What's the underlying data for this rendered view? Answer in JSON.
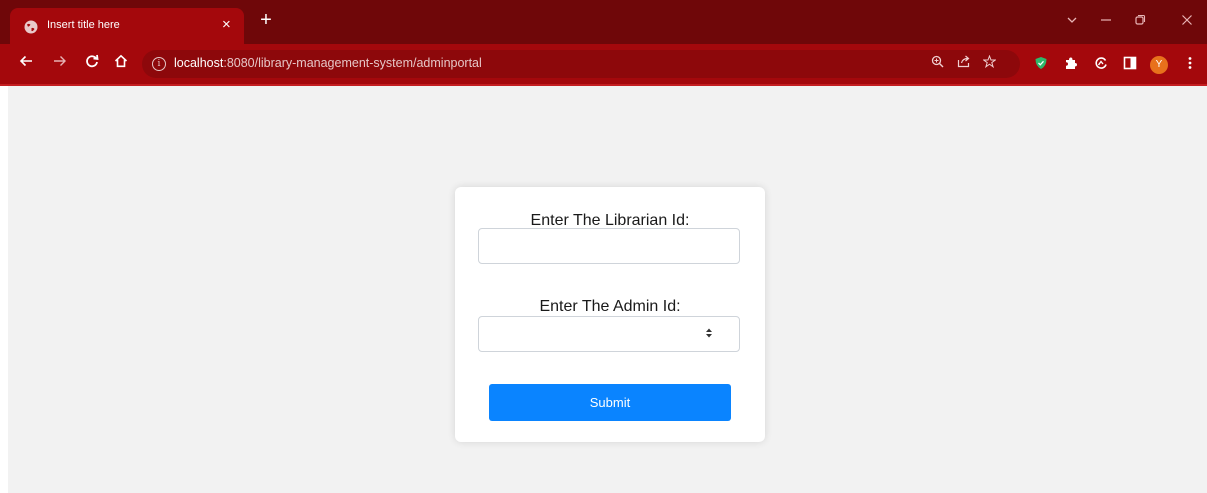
{
  "browser": {
    "tab_title": "Insert title here",
    "close_glyph": "×",
    "new_tab_glyph": "+",
    "url_host": "localhost",
    "url_path": ":8080/library-management-system/adminportal",
    "avatar_letter": "Y"
  },
  "icons": {
    "favicon": "globe-icon",
    "back": "back-arrow-icon",
    "forward": "forward-arrow-icon",
    "reload": "reload-icon",
    "home": "home-icon",
    "info": "info-icon",
    "zoom": "zoom-icon",
    "share": "share-icon",
    "bookmark": "star-icon",
    "extensions": [
      "shield-icon",
      "puzzle-icon",
      "sync-icon",
      "sidepanel-icon"
    ],
    "menu": "kebab-menu-icon"
  },
  "form": {
    "librarian_label": "Enter The Librarian Id:",
    "librarian_value": "",
    "admin_label": "Enter The Admin Id:",
    "admin_value": "",
    "submit_label": "Submit"
  },
  "colors": {
    "tab_strip": "#6f0709",
    "toolbar": "#a4080c",
    "page_bg": "#f2f2f2",
    "submit_button": "#0a84ff",
    "avatar": "#e8711c",
    "shield": "#2fb86b"
  }
}
